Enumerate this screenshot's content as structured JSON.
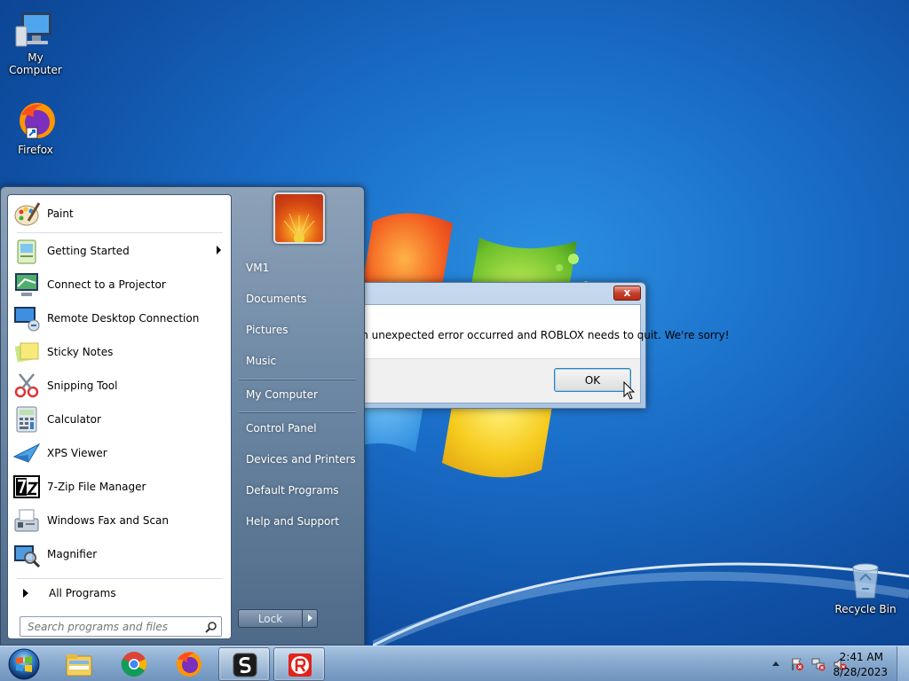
{
  "desktop": {
    "icons": [
      {
        "label": "My Computer"
      },
      {
        "label": "Firefox"
      },
      {
        "label": "Recycle Bin"
      }
    ]
  },
  "dialog": {
    "close_label": "x",
    "message": "An unexpected error occurred and ROBLOX needs to quit.  We're sorry!",
    "ok_label": "OK"
  },
  "start_menu": {
    "programs": [
      {
        "label": "Paint",
        "icon": "paint-icon"
      },
      {
        "label": "Getting Started",
        "icon": "getting-started-icon",
        "has_submenu": true
      },
      {
        "label": "Connect to a Projector",
        "icon": "projector-icon"
      },
      {
        "label": "Remote Desktop Connection",
        "icon": "remote-desktop-icon"
      },
      {
        "label": "Sticky Notes",
        "icon": "sticky-notes-icon"
      },
      {
        "label": "Snipping Tool",
        "icon": "snipping-tool-icon"
      },
      {
        "label": "Calculator",
        "icon": "calculator-icon"
      },
      {
        "label": "XPS Viewer",
        "icon": "xps-viewer-icon"
      },
      {
        "label": "7-Zip File Manager",
        "icon": "seven-zip-icon"
      },
      {
        "label": "Windows Fax and Scan",
        "icon": "fax-scan-icon"
      },
      {
        "label": "Magnifier",
        "icon": "magnifier-icon"
      }
    ],
    "all_programs": "All Programs",
    "search_placeholder": "Search programs and files",
    "right_items": [
      {
        "label": "VM1"
      },
      {
        "label": "Documents"
      },
      {
        "label": "Pictures"
      },
      {
        "label": "Music"
      },
      {
        "label": "My Computer"
      },
      {
        "label": "Control Panel"
      },
      {
        "label": "Devices and Printers"
      },
      {
        "label": "Default Programs"
      },
      {
        "label": "Help and Support"
      }
    ],
    "lock_label": "Lock"
  },
  "taskbar": {
    "apps": [
      "Windows Explorer",
      "Google Chrome",
      "Firefox",
      "Sandboxie",
      "ROBLOX"
    ],
    "clock": {
      "time": "2:41 AM",
      "date": "8/28/2023"
    }
  }
}
